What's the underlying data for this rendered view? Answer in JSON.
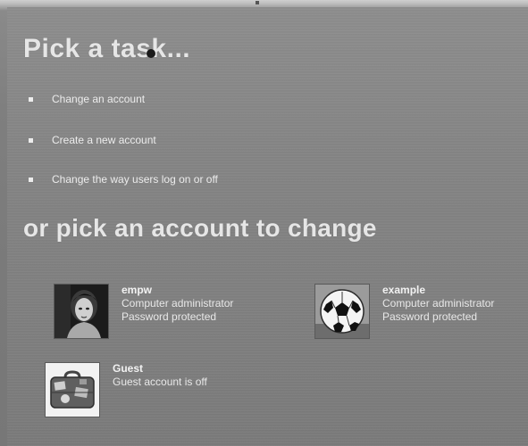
{
  "window": {
    "task_heading": "Pick a task...",
    "account_heading": "or pick an account to change"
  },
  "tasks": [
    {
      "label": "Change an account"
    },
    {
      "label": "Create a new account"
    },
    {
      "label": "Change the way users log on or off"
    }
  ],
  "accounts": [
    {
      "name": "empw",
      "role": "Computer administrator",
      "status": "Password protected",
      "picture": "portrait-icon"
    },
    {
      "name": "example",
      "role": "Computer administrator",
      "status": "Password protected",
      "picture": "soccer-ball-icon"
    },
    {
      "name": "Guest",
      "status": "Guest account is off",
      "picture": "suitcase-icon"
    }
  ],
  "colors": {
    "background": "#858585",
    "heading_text": "#e6e6e6",
    "body_text": "#ececec"
  }
}
